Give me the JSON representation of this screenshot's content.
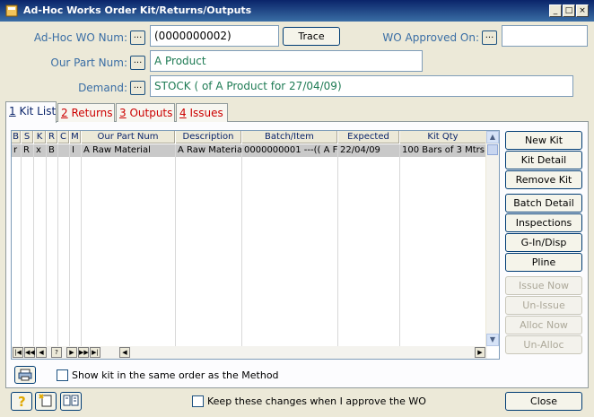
{
  "window": {
    "title": "Ad-Hoc Works Order Kit/Returns/Outputs",
    "controls": [
      "_",
      "□",
      "×"
    ]
  },
  "form": {
    "wo_num_label": "Ad-Hoc WO Num:",
    "wo_num_value": "(0000000002)",
    "trace_label": "Trace",
    "approved_label": "WO Approved On:",
    "approved_value": "",
    "part_num_label": "Our Part Num:",
    "part_num_value": "A Product",
    "demand_label": "Demand:",
    "demand_value": "STOCK ( of A Product for 27/04/09)",
    "dot_label": "..."
  },
  "tabs": [
    {
      "num": "1",
      "label": " Kit List",
      "active": true
    },
    {
      "num": "2",
      "label": " Returns",
      "active": false
    },
    {
      "num": "3",
      "label": " Outputs",
      "active": false
    },
    {
      "num": "4",
      "label": " Issues",
      "active": false
    }
  ],
  "grid": {
    "columns": [
      "B",
      "S",
      "K",
      "R",
      "C",
      "M",
      "Our Part Num",
      "Description",
      "Batch/Item",
      "Expected",
      "Kit Qty"
    ],
    "rows": [
      [
        "r",
        "R",
        "x",
        "B",
        "",
        "I",
        "A Raw Material",
        "A Raw Material",
        "0000000001      ---(( A F",
        "22/04/09",
        "100 Bars of 3 Mtrs"
      ]
    ],
    "nav": [
      "|◀",
      "◀◀",
      "◀",
      "?",
      "▶",
      "▶▶",
      "▶|"
    ]
  },
  "actions": {
    "new_kit": "New Kit",
    "kit_detail": "Kit Detail",
    "remove_kit": "Remove Kit",
    "batch_detail": "Batch Detail",
    "inspections": "Inspections",
    "g_in_disp": "G-In/Disp",
    "pline": "Pline",
    "issue_now": "Issue Now",
    "un_issue": "Un-Issue",
    "alloc_now": "Alloc Now",
    "un_alloc": "Un-Alloc"
  },
  "options": {
    "show_kit_order": "Show kit in the same order as the Method",
    "keep_changes": "Keep these changes when I approve the WO"
  },
  "footer": {
    "close_label": "Close"
  },
  "colors": {
    "label_blue": "#3A6EA5",
    "field_green": "#1E7B54",
    "tab_red": "#C00000",
    "title_bar": "#0A246A"
  }
}
